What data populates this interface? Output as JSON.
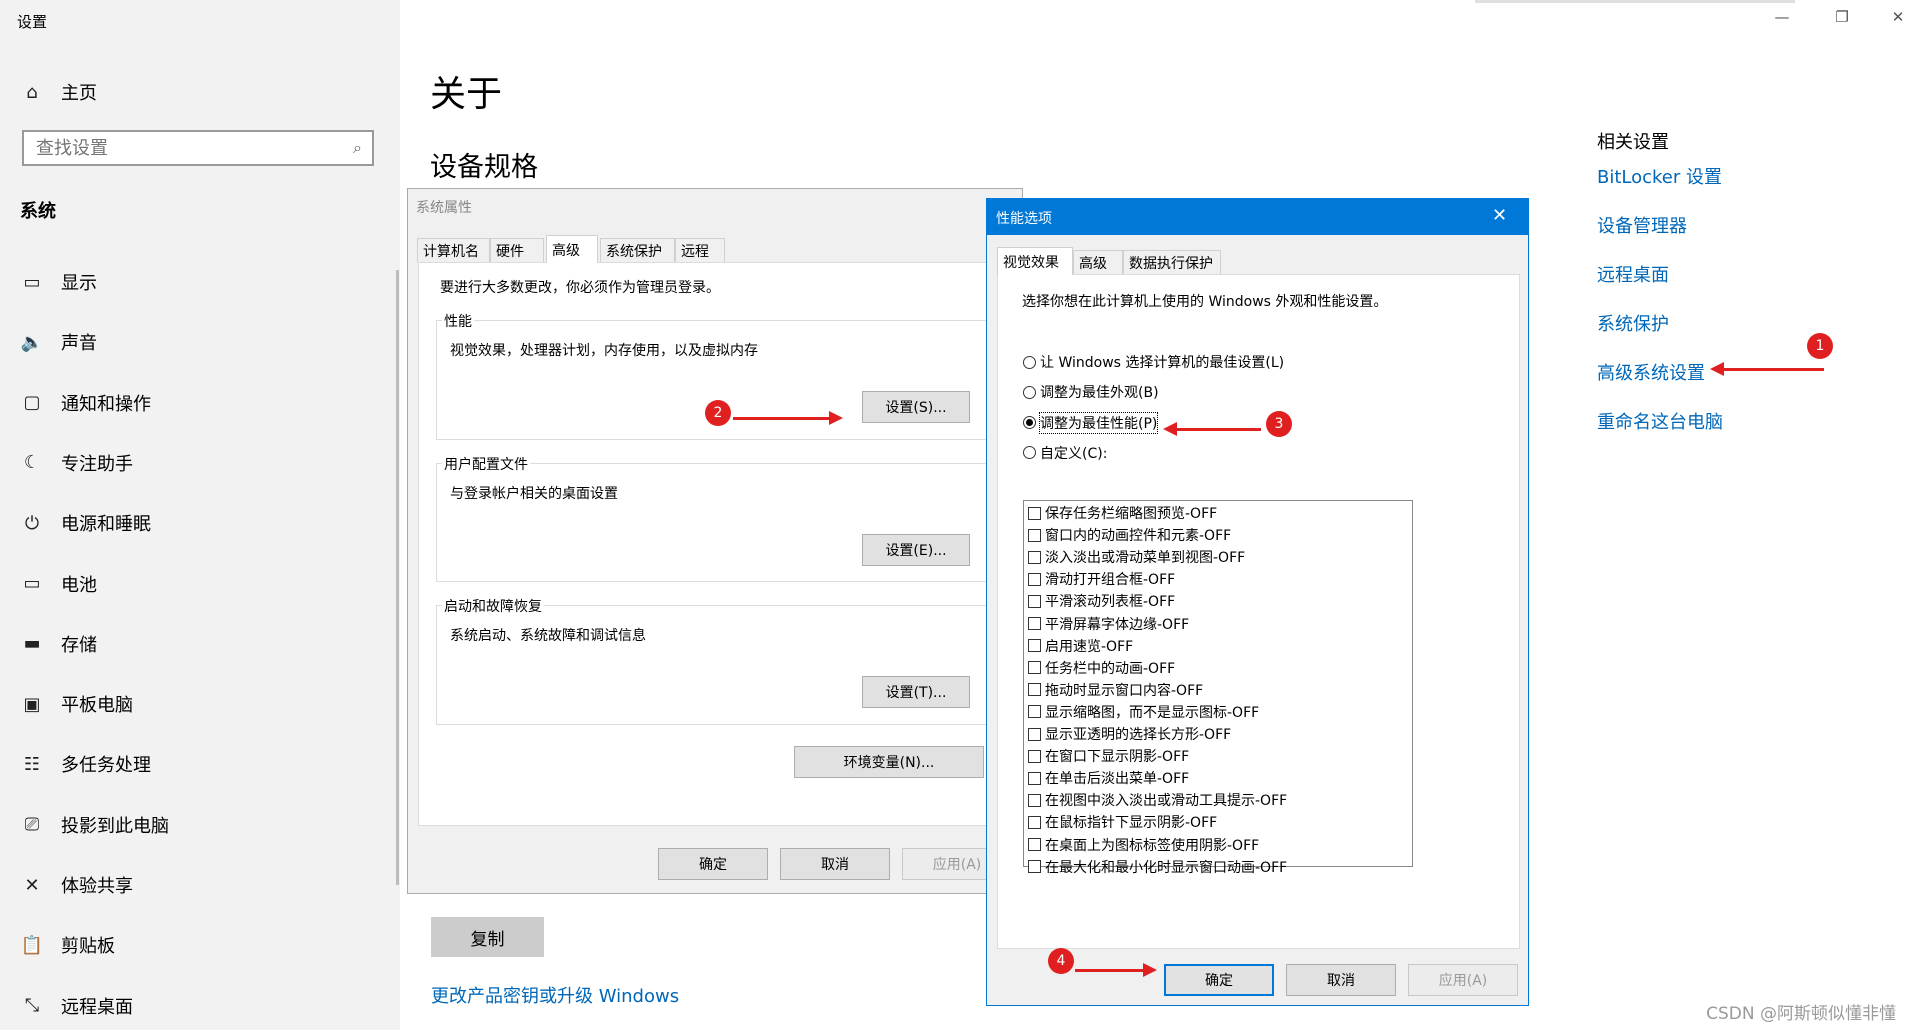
{
  "app": {
    "title": "设置"
  },
  "sidebar": {
    "home": "主页",
    "search_placeholder": "查找设置",
    "section": "系统",
    "items": [
      {
        "label": "显示",
        "icon": "display-icon"
      },
      {
        "label": "声音",
        "icon": "sound-icon"
      },
      {
        "label": "通知和操作",
        "icon": "notification-icon"
      },
      {
        "label": "专注助手",
        "icon": "moon-icon"
      },
      {
        "label": "电源和睡眠",
        "icon": "power-icon"
      },
      {
        "label": "电池",
        "icon": "battery-icon"
      },
      {
        "label": "存储",
        "icon": "storage-icon"
      },
      {
        "label": "平板电脑",
        "icon": "tablet-icon"
      },
      {
        "label": "多任务处理",
        "icon": "multitask-icon"
      },
      {
        "label": "投影到此电脑",
        "icon": "project-icon"
      },
      {
        "label": "体验共享",
        "icon": "share-icon"
      },
      {
        "label": "剪贴板",
        "icon": "clipboard-icon"
      },
      {
        "label": "远程桌面",
        "icon": "remote-icon"
      }
    ]
  },
  "main": {
    "title": "关于",
    "section": "设备规格",
    "copy_button": "复制",
    "upgrade_link": "更改产品密钥或升级 Windows"
  },
  "related": {
    "title": "相关设置",
    "links": [
      "BitLocker 设置",
      "设备管理器",
      "远程桌面",
      "系统保护",
      "高级系统设置",
      "重命名这台电脑"
    ]
  },
  "sysprops": {
    "title": "系统属性",
    "tabs": [
      "计算机名",
      "硬件",
      "高级",
      "系统保护",
      "远程"
    ],
    "admin_note": "要进行大多数更改，你必须作为管理员登录。",
    "performance": {
      "legend": "性能",
      "desc": "视觉效果，处理器计划，内存使用，以及虚拟内存",
      "button": "设置(S)..."
    },
    "profiles": {
      "legend": "用户配置文件",
      "desc": "与登录帐户相关的桌面设置",
      "button": "设置(E)..."
    },
    "startup": {
      "legend": "启动和故障恢复",
      "desc": "系统启动、系统故障和调试信息",
      "button": "设置(T)..."
    },
    "env_button": "环境变量(N)...",
    "ok": "确定",
    "cancel": "取消",
    "apply": "应用(A)"
  },
  "perfopts": {
    "title": "性能选项",
    "tabs": [
      "视觉效果",
      "高级",
      "数据执行保护"
    ],
    "intro": "选择你想在此计算机上使用的 Windows 外观和性能设置。",
    "radios": [
      {
        "label": "让 Windows 选择计算机的最佳设置(L)",
        "checked": false
      },
      {
        "label": "调整为最佳外观(B)",
        "checked": false
      },
      {
        "label": "调整为最佳性能(P)",
        "checked": true
      },
      {
        "label": "自定义(C):",
        "checked": false
      }
    ],
    "options": [
      "保存任务栏缩略图预览-OFF",
      "窗口内的动画控件和元素-OFF",
      "淡入淡出或滑动菜单到视图-OFF",
      "滑动打开组合框-OFF",
      "平滑滚动列表框-OFF",
      "平滑屏幕字体边缘-OFF",
      "启用速览-OFF",
      "任务栏中的动画-OFF",
      "拖动时显示窗口内容-OFF",
      "显示缩略图，而不是显示图标-OFF",
      "显示亚透明的选择长方形-OFF",
      "在窗口下显示阴影-OFF",
      "在单击后淡出菜单-OFF",
      "在视图中淡入淡出或滑动工具提示-OFF",
      "在鼠标指针下显示阴影-OFF",
      "在桌面上为图标标签使用阴影-OFF",
      "在最大化和最小化时显示窗口动画-OFF"
    ],
    "ok": "确定",
    "cancel": "取消",
    "apply": "应用(A)"
  },
  "annotations": [
    "1",
    "2",
    "3",
    "4"
  ],
  "watermark": "CSDN @阿斯顿似懂非懂",
  "colors": {
    "link": "#0067b8",
    "accent": "#0078d7",
    "marker": "#e02020"
  }
}
